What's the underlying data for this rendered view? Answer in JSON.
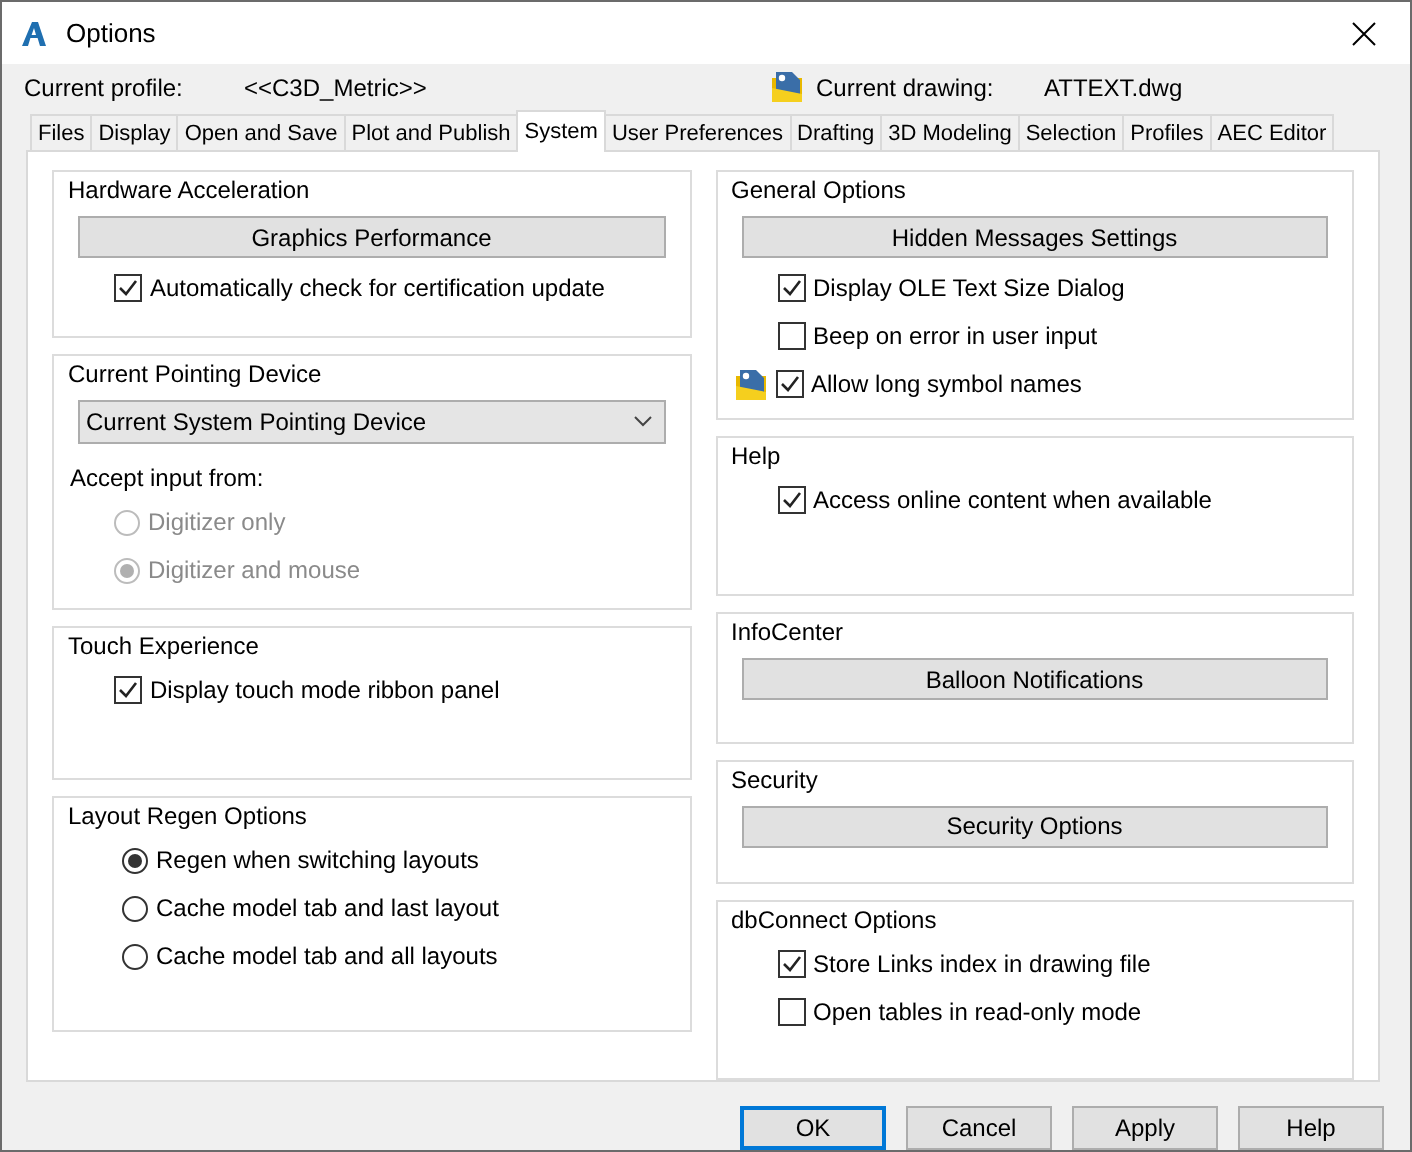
{
  "window": {
    "title": "Options"
  },
  "profile": {
    "label": "Current profile:",
    "value": "<<C3D_Metric>>"
  },
  "drawing": {
    "label": "Current drawing:",
    "value": "ATTEXT.dwg"
  },
  "tabs": [
    {
      "label": "Files",
      "selected": false
    },
    {
      "label": "Display",
      "selected": false
    },
    {
      "label": "Open and Save",
      "selected": false
    },
    {
      "label": "Plot and Publish",
      "selected": false
    },
    {
      "label": "System",
      "selected": true
    },
    {
      "label": "User Preferences",
      "selected": false
    },
    {
      "label": "Drafting",
      "selected": false
    },
    {
      "label": "3D Modeling",
      "selected": false
    },
    {
      "label": "Selection",
      "selected": false
    },
    {
      "label": "Profiles",
      "selected": false
    },
    {
      "label": "AEC Editor",
      "selected": false
    }
  ],
  "left_groups": [
    {
      "title": "Hardware Acceleration",
      "items": [
        {
          "kind": "button",
          "label": "Graphics Performance"
        },
        {
          "kind": "checkbox",
          "label": "Automatically check for certification update",
          "checked": true
        }
      ]
    },
    {
      "title": "Current Pointing Device",
      "items": [
        {
          "kind": "dropdown",
          "label": "Current System Pointing Device"
        },
        {
          "kind": "label",
          "label": "Accept input from:",
          "children": [
            {
              "kind": "radio",
              "label": "Digitizer only",
              "selected": false,
              "disabled": true
            },
            {
              "kind": "radio",
              "label": "Digitizer and mouse",
              "selected": true,
              "disabled": true
            }
          ]
        }
      ]
    },
    {
      "title": "Touch Experience",
      "items": [
        {
          "kind": "checkbox",
          "label": "Display touch mode ribbon panel",
          "checked": true
        }
      ]
    },
    {
      "title": "Layout Regen Options",
      "items": [
        {
          "kind": "radio",
          "label": "Regen when switching layouts",
          "selected": true,
          "disabled": false
        },
        {
          "kind": "radio",
          "label": "Cache model tab and last layout",
          "selected": false,
          "disabled": false
        },
        {
          "kind": "radio",
          "label": "Cache model tab and all layouts",
          "selected": false,
          "disabled": false
        }
      ]
    }
  ],
  "right_groups": [
    {
      "title": "General Options",
      "items": [
        {
          "kind": "button",
          "label": "Hidden Messages Settings"
        },
        {
          "kind": "checkbox",
          "label": "Display OLE Text Size Dialog",
          "checked": true
        },
        {
          "kind": "checkbox",
          "label": "Beep on error in user input",
          "checked": false
        },
        {
          "kind": "checkbox",
          "label": "Allow long symbol names",
          "checked": true,
          "drawing_icon": true
        }
      ]
    },
    {
      "title": "Help",
      "items": [
        {
          "kind": "checkbox",
          "label": "Access online content when available",
          "checked": true
        }
      ]
    },
    {
      "title": "InfoCenter",
      "items": [
        {
          "kind": "button",
          "label": "Balloon Notifications"
        }
      ]
    },
    {
      "title": "Security",
      "items": [
        {
          "kind": "button",
          "label": "Security Options"
        }
      ]
    },
    {
      "title": "dbConnect Options",
      "items": [
        {
          "kind": "checkbox",
          "label": "Store Links index in drawing file",
          "checked": true
        },
        {
          "kind": "checkbox",
          "label": "Open tables in read-only mode",
          "checked": false
        }
      ]
    }
  ],
  "buttons": [
    {
      "label": "OK",
      "default": true
    },
    {
      "label": "Cancel",
      "default": false
    },
    {
      "label": "Apply",
      "default": false
    },
    {
      "label": "Help",
      "default": false
    }
  ]
}
